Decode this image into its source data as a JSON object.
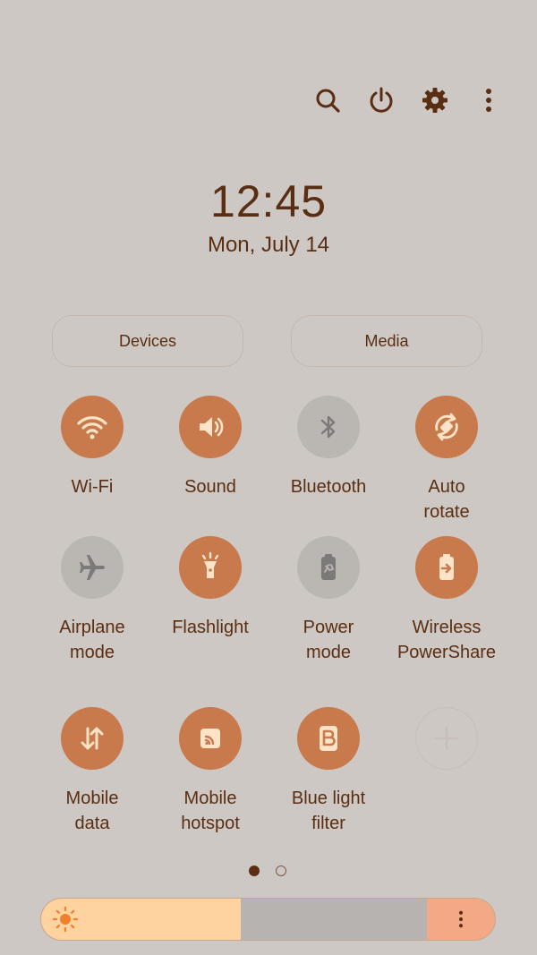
{
  "clock": {
    "time": "12:45",
    "date": "Mon, July 14"
  },
  "panel_buttons": {
    "devices": "Devices",
    "media": "Media"
  },
  "tiles": [
    {
      "label": "Wi-Fi",
      "icon": "wifi-icon",
      "state": "on"
    },
    {
      "label": "Sound",
      "icon": "speaker-icon",
      "state": "on"
    },
    {
      "label": "Bluetooth",
      "icon": "bluetooth-icon",
      "state": "off"
    },
    {
      "label": "Auto\nrotate",
      "icon": "auto-rotate-icon",
      "state": "on"
    },
    {
      "label": "Airplane\nmode",
      "icon": "airplane-icon",
      "state": "off"
    },
    {
      "label": "Flashlight",
      "icon": "flashlight-icon",
      "state": "on"
    },
    {
      "label": "Power\nmode",
      "icon": "battery-icon",
      "state": "off"
    },
    {
      "label": "Wireless\nPowerShare",
      "icon": "powershare-icon",
      "state": "on"
    },
    {
      "label": "Mobile\ndata",
      "icon": "mobile-data-icon",
      "state": "on"
    },
    {
      "label": "Mobile\nhotspot",
      "icon": "hotspot-icon",
      "state": "on"
    },
    {
      "label": "Blue light\nfilter",
      "icon": "blue-light-filter-icon",
      "state": "on"
    },
    {
      "label": "",
      "icon": "plus-icon",
      "state": "empty"
    }
  ],
  "pager": {
    "pages": 2,
    "current": 1
  },
  "brightness": {
    "level": 0.44
  },
  "colors": {
    "background": "#cdc8c4",
    "accent": "#c87a4c",
    "inactive": "#bab7b3",
    "text": "#5a2e12",
    "brightness_fill": "#fed39f"
  }
}
